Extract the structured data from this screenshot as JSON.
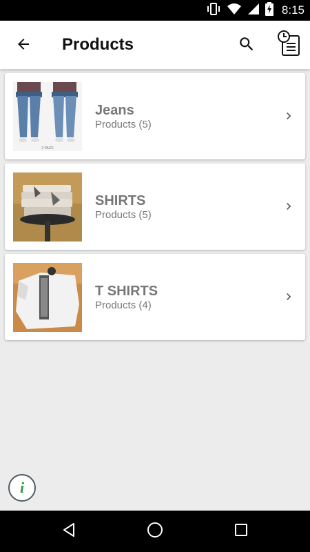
{
  "status_bar": {
    "time": "8:15",
    "icons": [
      "vibrate-icon",
      "wifi-icon",
      "signal-icon",
      "battery-charging-icon"
    ]
  },
  "app_bar": {
    "title": "Products",
    "back_icon": "arrow-back-icon",
    "search_icon": "search-icon",
    "history_icon": "order-history-icon"
  },
  "categories": [
    {
      "name": "Jeans",
      "count_label": "Products (5)",
      "thumb_label": "2 PACK",
      "thumbnail": "jeans-photo"
    },
    {
      "name": "SHIRTS",
      "count_label": "Products (5)",
      "thumbnail": "shirts-photo"
    },
    {
      "name": "T SHIRTS",
      "count_label": "Products (4)",
      "thumbnail": "tshirts-photo"
    }
  ],
  "info_button": {
    "glyph": "i",
    "icon": "info-icon"
  },
  "nav_bar": {
    "icons": [
      "back-triangle-icon",
      "home-circle-icon",
      "recents-square-icon"
    ]
  }
}
